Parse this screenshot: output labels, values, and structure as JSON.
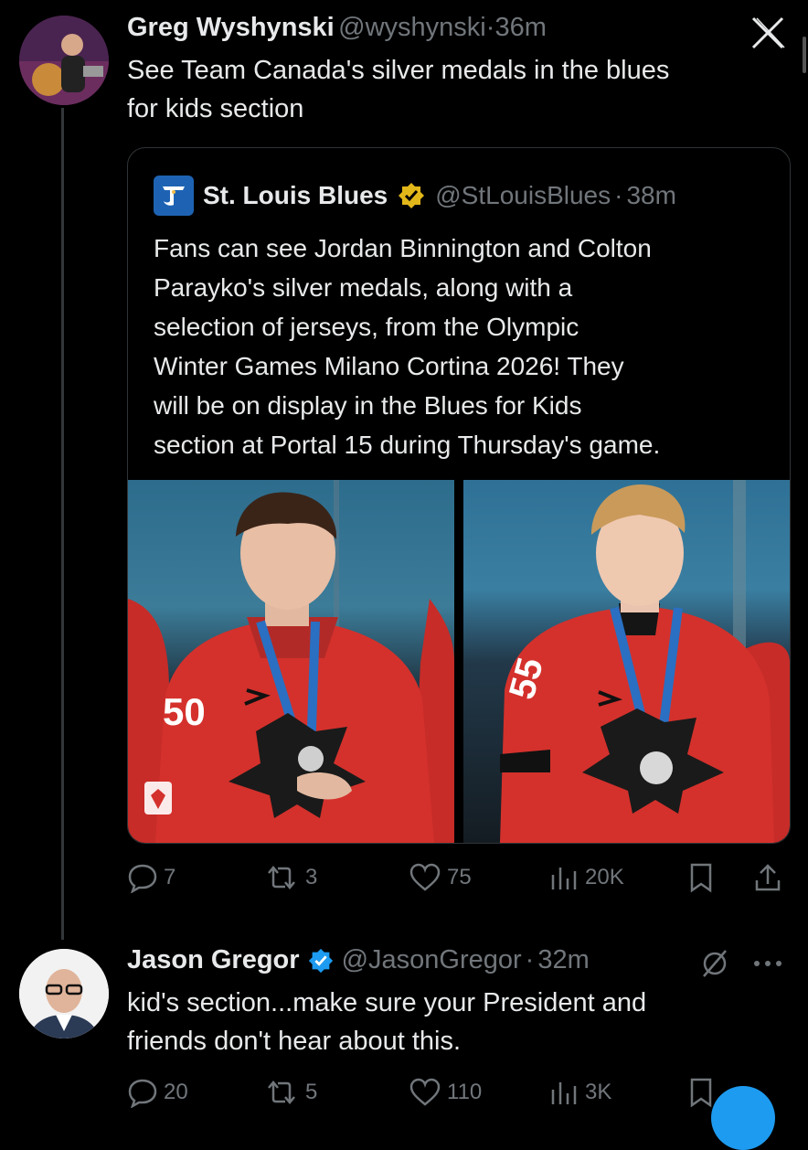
{
  "main_tweet": {
    "author_name": "Greg Wyshynski",
    "handle": "@wyshynski",
    "time": "36m",
    "text_line1": "See Team Canada's silver medals in the blues",
    "text_line2": "for kids section",
    "close_label": "X"
  },
  "quoted_tweet": {
    "author_name": "St. Louis Blues",
    "handle": "@StLouisBlues",
    "time": "38m",
    "lines": [
      "Fans can see Jordan Binnington and Colton",
      "Parayko's silver medals, along with a",
      "selection of jerseys, from the Olympic",
      "Winter Games Milano Cortina 2026! They",
      "will be on display in the Blues for Kids",
      "section at Portal 15 during Thursday's game."
    ],
    "jersey_number_left": "50",
    "jersey_number_right": "55"
  },
  "actions": {
    "replies": "7",
    "reposts": "3",
    "likes": "75",
    "views": "20K"
  },
  "reply_tweet": {
    "author_name": "Jason Gregor",
    "handle": "@JasonGregor",
    "time": "32m",
    "text_line1": "kid's section...make sure your President and",
    "text_line2": "friends don't hear about this.",
    "replies": "20",
    "reposts": "5",
    "likes": "110",
    "views": "3K"
  },
  "colors": {
    "background": "#000000",
    "text": "#e7e9ea",
    "muted": "#71767b",
    "verified_gold": "#e2b719",
    "verified_blue": "#1d9bf0",
    "jersey_red": "#d4312c"
  }
}
